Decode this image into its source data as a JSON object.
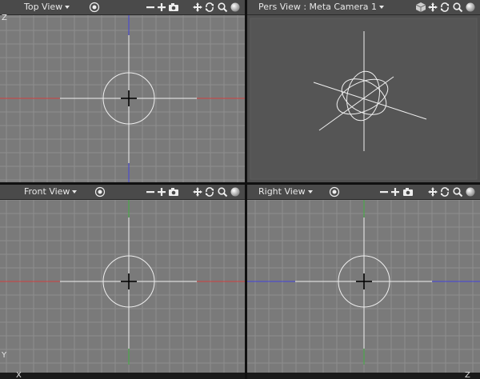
{
  "viewports": {
    "top": {
      "title": "Top View",
      "axis_v": "Z",
      "axis_v2": "−"
    },
    "pers": {
      "title": "Pers View : Meta Camera 1"
    },
    "front": {
      "title": "Front View",
      "axis_v": "Y"
    },
    "right": {
      "title": "Right View"
    }
  },
  "bottom_axis": {
    "left": "X",
    "right": "Z"
  },
  "colors": {
    "viewport_bg": "#7a7a7a",
    "pers_bg": "#4f4f4f",
    "grid": "#8e8e8e",
    "axis_x": "#d04040",
    "axis_z": "#4444dd",
    "axis_y": "#40b040",
    "object": "#f0f0f0"
  },
  "icons": {
    "menu": "target-icon",
    "zoom_out": "minus-icon",
    "zoom_in": "plus-icon",
    "snapshot": "camera-icon",
    "pan": "move-icon",
    "rotate": "rotate-icon",
    "zoom": "magnifier-icon",
    "render": "sphere-icon",
    "view_cube": "cube-icon"
  }
}
